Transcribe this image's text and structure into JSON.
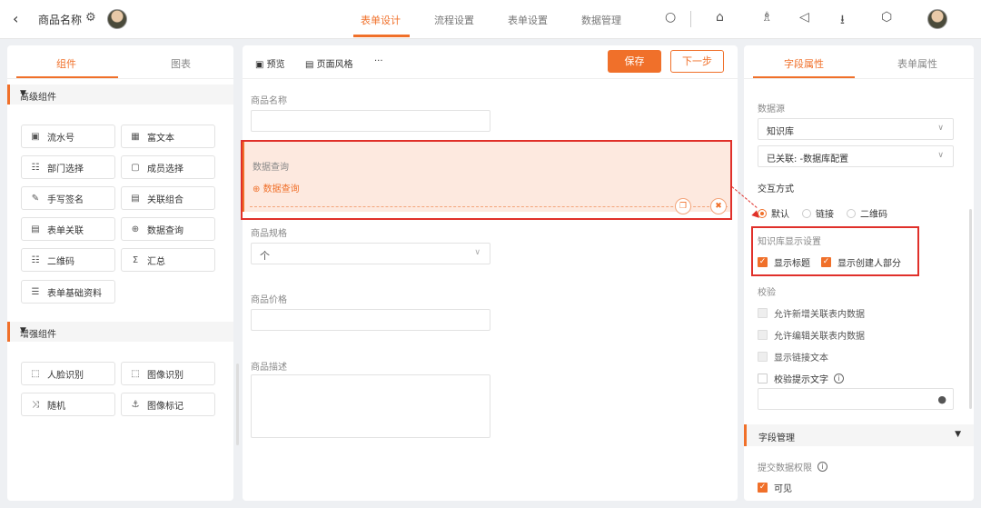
{
  "header": {
    "back_icon": "chevron-left-icon",
    "title": "商品名称",
    "tabs": [
      {
        "label": "表单设计",
        "active": true
      },
      {
        "label": "流程设置",
        "active": false
      },
      {
        "label": "表单设置",
        "active": false
      },
      {
        "label": "数据管理",
        "active": false
      }
    ],
    "icons": [
      "search-icon",
      "home-icon",
      "shirt-icon",
      "megaphone-icon",
      "download-icon",
      "hexagon-settings-icon"
    ]
  },
  "left": {
    "tabs": [
      "组件",
      "图表"
    ],
    "sections": [
      {
        "title": "高级组件",
        "items": [
          "流水号",
          "富文本",
          "部门选择",
          "成员选择",
          "手写签名",
          "关联组合",
          "表单关联",
          "数据查询",
          "二维码",
          "汇总",
          "表单基础资料"
        ]
      },
      {
        "title": "增强组件",
        "items": [
          "人脸识别",
          "图像识别",
          "随机",
          "图像标记"
        ]
      }
    ]
  },
  "center": {
    "toolbar": {
      "preview": "预览",
      "page_style": "页面风格",
      "more": "···",
      "save": "保存",
      "next": "下一步"
    },
    "fields": {
      "name_label": "商品名称",
      "query_label": "数据查询",
      "query_link": "数据查询",
      "spec_label": "商品规格",
      "spec_value": "个",
      "price_label": "商品价格",
      "desc_label": "商品描述"
    }
  },
  "right": {
    "tabs": [
      "字段属性",
      "表单属性"
    ],
    "data_source_label": "数据源",
    "data_source_value": "知识库",
    "linked_value": "已关联: -数据库配置",
    "interaction_label": "交互方式",
    "interaction_options": [
      {
        "label": "默认",
        "selected": true
      },
      {
        "label": "链接",
        "selected": false
      },
      {
        "label": "二维码",
        "selected": false
      }
    ],
    "kb_display_label": "知识库显示设置",
    "kb_display_options": [
      {
        "label": "显示标题",
        "checked": true
      },
      {
        "label": "显示创建人部分",
        "checked": true
      }
    ],
    "validation_label": "校验",
    "validation_options": [
      {
        "label": "允许新增关联表内数据",
        "checked": false,
        "disabled": true
      },
      {
        "label": "允许编辑关联表内数据",
        "checked": false,
        "disabled": true
      },
      {
        "label": "显示链接文本",
        "checked": false,
        "disabled": true
      },
      {
        "label": "校验提示文字",
        "checked": false,
        "disabled": false
      }
    ],
    "field_mgmt_title": "字段管理",
    "submit_perm_label": "提交数据权限",
    "visible_label": "可见",
    "visible_checked": true
  },
  "colors": {
    "accent": "#f0702a",
    "highlight": "#e0302a",
    "query_bg": "#fde9df"
  }
}
